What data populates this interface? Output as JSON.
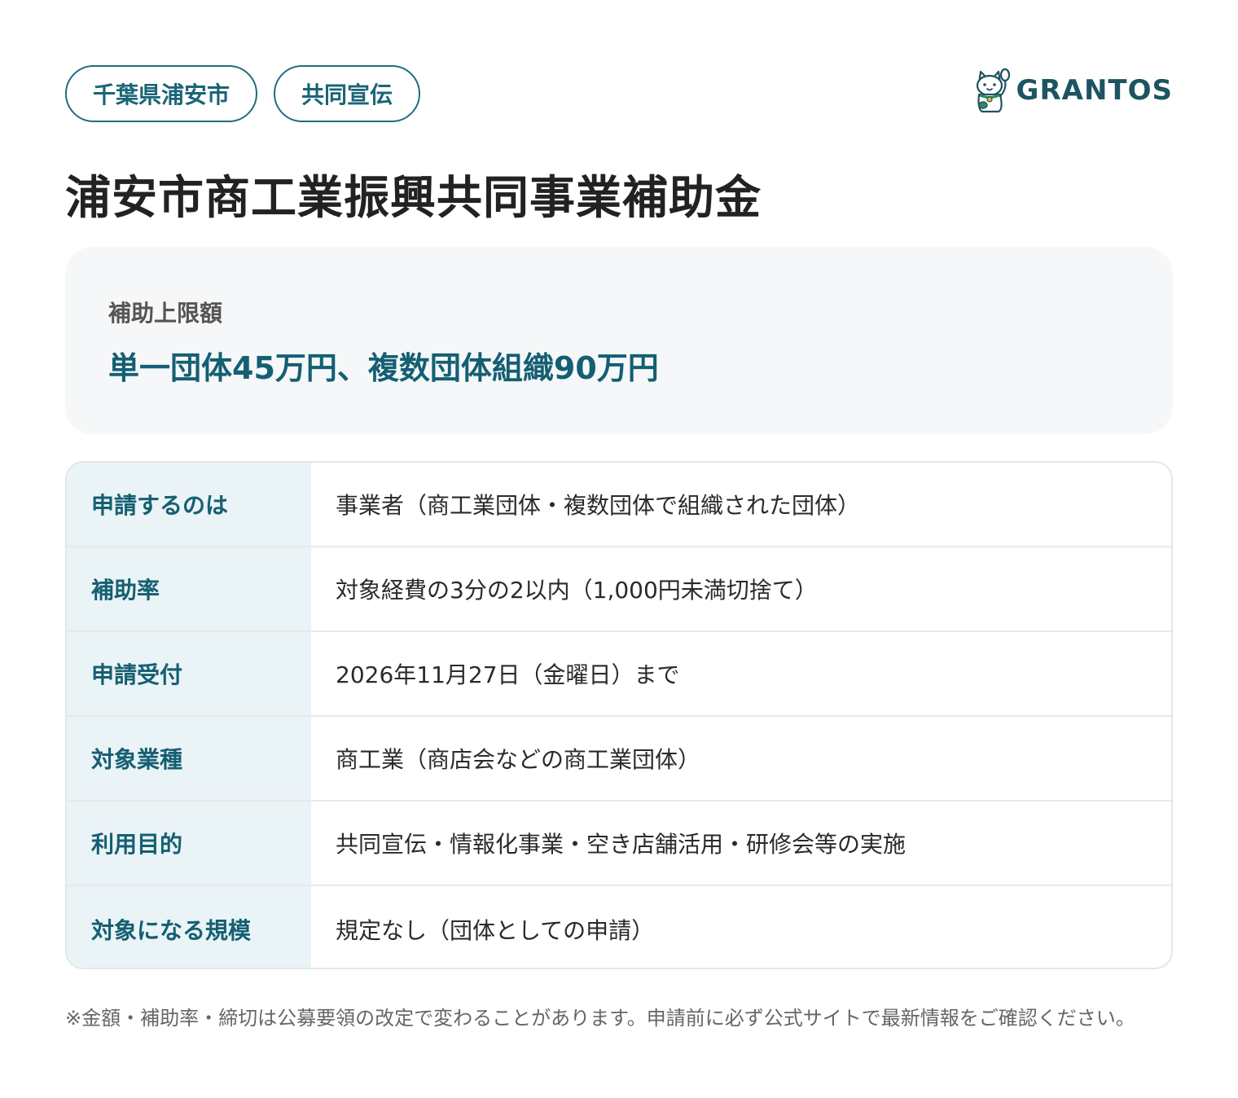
{
  "tags": [
    "千葉県浦安市",
    "共同宣伝"
  ],
  "logo": {
    "text": "GRANTOS",
    "icon": "maneki-neko-cat-icon"
  },
  "title": "浦安市商工業振興共同事業補助金",
  "highlight": {
    "label": "補助上限額",
    "value": "単一団体45万円、複数団体組織90万円"
  },
  "details": [
    {
      "label": "申請するのは",
      "value": "事業者（商工業団体・複数団体で組織された団体）"
    },
    {
      "label": "補助率",
      "value": "対象経費の3分の2以内（1,000円未満切捨て）"
    },
    {
      "label": "申請受付",
      "value": "2026年11月27日（金曜日）まで"
    },
    {
      "label": "対象業種",
      "value": "商工業（商店会などの商工業団体）"
    },
    {
      "label": "利用目的",
      "value": "共同宣伝・情報化事業・空き店舗活用・研修会等の実施"
    },
    {
      "label": "対象になる規模",
      "value": "規定なし（団体としての申請）"
    }
  ],
  "note": "※金額・補助率・締切は公募要領の改定で変わることがあります。申請前に必ず公式サイトで最新情報をご確認ください。",
  "colors": {
    "accent": "#1a6577",
    "label_bg": "#eaf3f6",
    "card_bg": "#f5f7f8"
  }
}
